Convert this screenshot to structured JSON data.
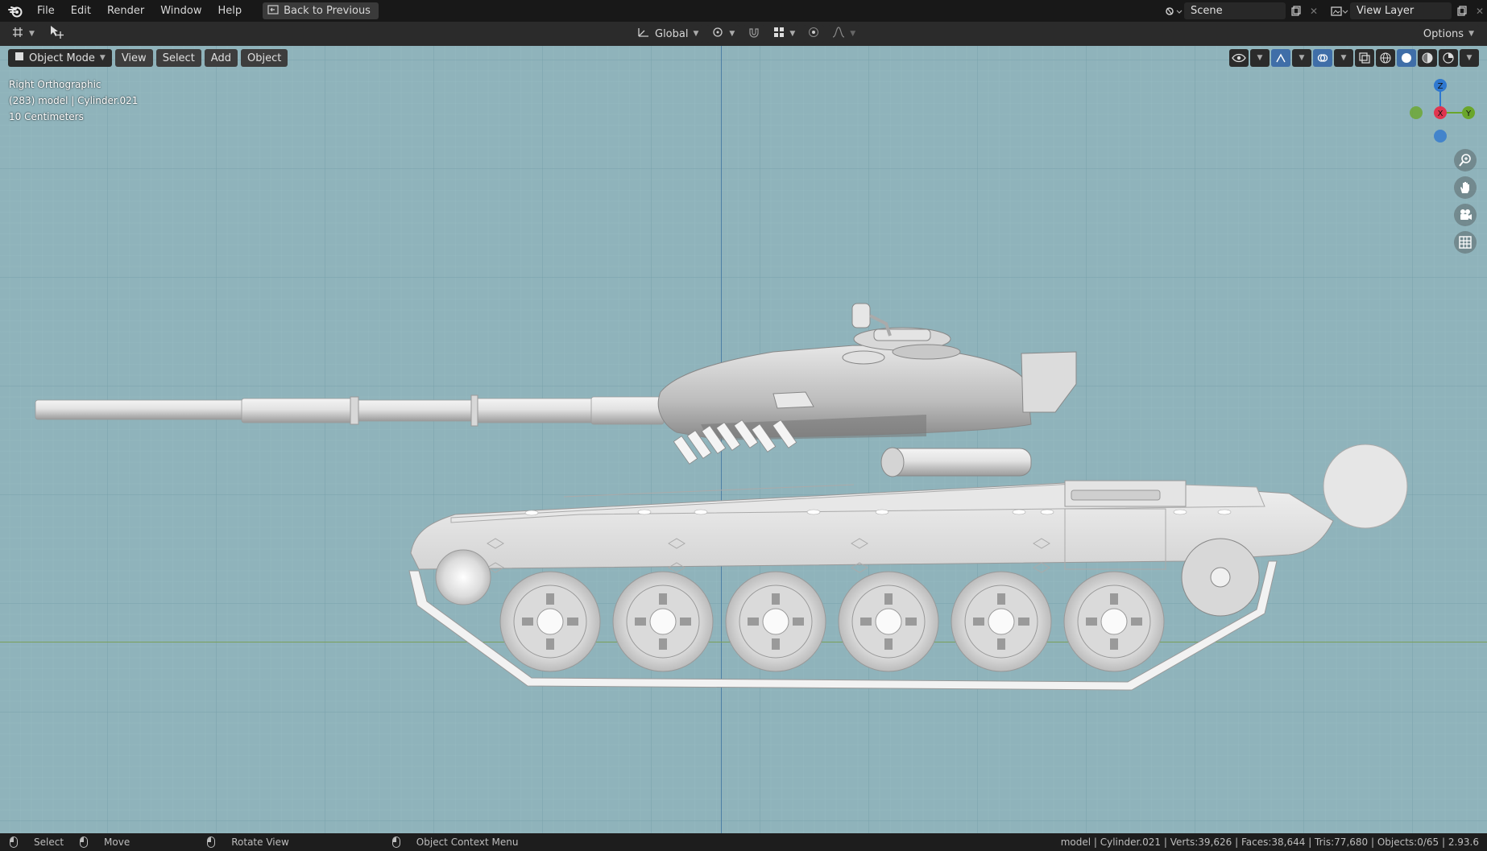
{
  "menu": {
    "items": [
      "File",
      "Edit",
      "Render",
      "Window",
      "Help"
    ],
    "back_button": "Back to Previous"
  },
  "top_right": {
    "scene": "Scene",
    "view_layer": "View Layer"
  },
  "toolbar": {
    "transform_orientation": "Global",
    "options": "Options"
  },
  "viewport_header": {
    "mode": "Object Mode",
    "view": "View",
    "select": "Select",
    "add": "Add",
    "object": "Object"
  },
  "overlay": {
    "view_name": "Right Orthographic",
    "object_info": "(283) model | Cylinder.021",
    "scale": "10 Centimeters"
  },
  "gizmo": {
    "z": "Z",
    "x": "X",
    "y": "Y",
    "colors": {
      "z": "#2f78d0",
      "x": "#e0354f",
      "y": "#6aa62b"
    }
  },
  "statusbar": {
    "select": "Select",
    "move": "Move",
    "rotate": "Rotate View",
    "context": "Object Context Menu",
    "stats": "model | Cylinder.021 | Verts:39,626 | Faces:38,644 | Tris:77,680 | Objects:0/65 | 2.93.6"
  }
}
